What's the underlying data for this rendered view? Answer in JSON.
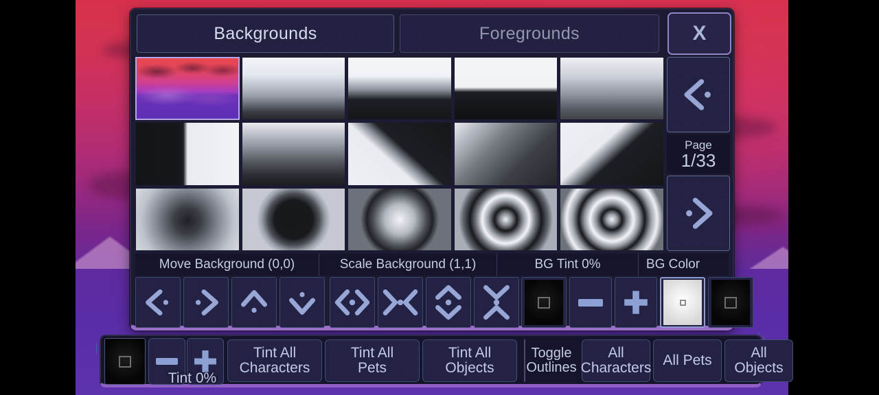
{
  "tabs": {
    "backgrounds": "Backgrounds",
    "foregrounds": "Foregrounds",
    "close": "X"
  },
  "pagination": {
    "page_label": "Page",
    "page_value": "1/33",
    "prev_icon": "chevron-left-dot-icon",
    "next_icon": "chevron-right-dot-icon"
  },
  "sections": {
    "move": "Move Background (0,0)",
    "scale": "Scale Background (1,1)",
    "tint": "BG Tint 0%",
    "color": "BG Color"
  },
  "controls": {
    "move_left": "move-left-icon",
    "move_right": "move-right-icon",
    "move_up": "move-up-icon",
    "move_down": "move-down-icon",
    "scale_wider": "scale-wider-icon",
    "scale_narrower": "scale-narrower-icon",
    "scale_taller": "scale-taller-icon",
    "scale_shorter": "scale-shorter-icon",
    "tint_swatch": "black-swatch",
    "tint_minus": "–",
    "tint_plus": "+",
    "color_white": "white-swatch",
    "color_black": "black-swatch"
  },
  "bottom_bar": {
    "tint_swatch": "black-swatch",
    "tint_minus": "–",
    "tint_plus": "+",
    "tint_value": "Tint 0%",
    "tint_all_characters_line1": "Tint All",
    "tint_all_characters_line2": "Characters",
    "tint_all_pets_line1": "Tint All",
    "tint_all_pets_line2": "Pets",
    "tint_all_objects_line1": "Tint All",
    "tint_all_objects_line2": "Objects",
    "toggle_outlines_line1": "Toggle",
    "toggle_outlines_line2": "Outlines",
    "all_characters_line1": "All",
    "all_characters_line2": "Characters",
    "all_pets": "All Pets",
    "all_objects_line1": "All",
    "all_objects_line2": "Objects"
  },
  "colors": {
    "panel_bg": "#1c1b33",
    "panel_accent": "#9b6fc9",
    "button_bg": "#232144",
    "text": "#c6cfe6",
    "selected_border": "#b8a6e8",
    "sky_top": "#d6304d",
    "sky_bottom": "#6239b5"
  },
  "thumbnails": [
    {
      "index": 1,
      "name": "landscape-sunset-scene",
      "selected": true,
      "style": "landscape"
    },
    {
      "index": 2,
      "name": "gradient-vertical-light-top",
      "selected": false,
      "style": "g2"
    },
    {
      "index": 3,
      "name": "gradient-vertical-hard-split",
      "selected": false,
      "style": "g3"
    },
    {
      "index": 4,
      "name": "gradient-vertical-band",
      "selected": false,
      "style": "g4"
    },
    {
      "index": 5,
      "name": "gradient-vertical-soft-grey",
      "selected": false,
      "style": "g5"
    },
    {
      "index": 6,
      "name": "gradient-horizontal-split",
      "selected": false,
      "style": "g6"
    },
    {
      "index": 7,
      "name": "gradient-horizontal-soft",
      "selected": false,
      "style": "g7"
    },
    {
      "index": 8,
      "name": "gradient-diagonal-up-right",
      "selected": false,
      "style": "g8"
    },
    {
      "index": 9,
      "name": "gradient-corner-light",
      "selected": false,
      "style": "g9"
    },
    {
      "index": 10,
      "name": "gradient-diagonal-down-right",
      "selected": false,
      "style": "g10"
    },
    {
      "index": 11,
      "name": "radial-dark-center-soft",
      "selected": false,
      "style": "g11"
    },
    {
      "index": 12,
      "name": "radial-dark-ellipse",
      "selected": false,
      "style": "g12"
    },
    {
      "index": 13,
      "name": "radial-light-center",
      "selected": false,
      "style": "g13"
    },
    {
      "index": 14,
      "name": "radial-rings-double",
      "selected": false,
      "style": "g14"
    },
    {
      "index": 15,
      "name": "radial-rings-triple",
      "selected": false,
      "style": "g15"
    }
  ]
}
